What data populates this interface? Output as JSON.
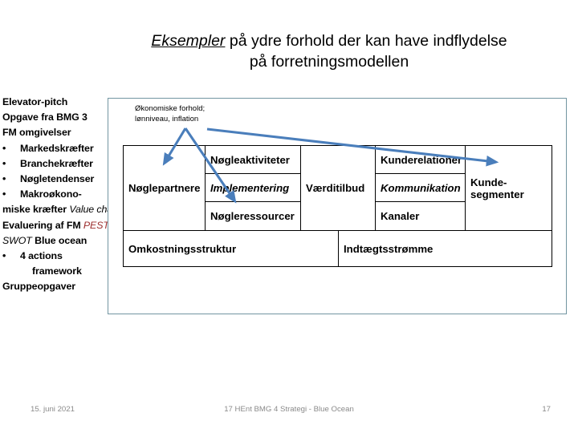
{
  "slide": {
    "title_emphasis": "Eksempler",
    "title_rest": " på ydre forhold der kan have indflydelse",
    "title_line2": "på forretningsmodellen"
  },
  "agenda": {
    "items": [
      {
        "text": "Elevator-pitch",
        "style": "bold"
      },
      {
        "text": "Opgave fra BMG 3",
        "style": "bold"
      },
      {
        "text": "FM omgivelser",
        "style": "bold"
      },
      {
        "text": "Markedskræfter",
        "style": "bullet"
      },
      {
        "text": "Branchekræfter",
        "style": "bullet"
      },
      {
        "text": "Nøgletendenser",
        "style": "bullet"
      },
      {
        "text": "Makroøkono-",
        "style": "bullet"
      },
      {
        "text": "miske kræfter",
        "style": "bold"
      },
      {
        "text": "Value chain",
        "style": "italic"
      },
      {
        "text": "Evaluering af FM",
        "style": "bold"
      },
      {
        "text": "PEST",
        "style": "pest"
      },
      {
        "text": "SWOT",
        "style": "swot"
      },
      {
        "text": "Blue ocean",
        "style": "bold"
      },
      {
        "text": "4 actions",
        "style": "bullet"
      },
      {
        "text": "framework",
        "style": "indent"
      },
      {
        "text": "Gruppeopgaver",
        "style": "bold"
      }
    ]
  },
  "annotation": {
    "econ_line1": "Økonomiske forhold;",
    "econ_line2": "lønniveau, inflation"
  },
  "canvas": {
    "cells": [
      {
        "name": "key-partners",
        "label": "Nøglepartnere",
        "italic": false
      },
      {
        "name": "key-activities",
        "label": "Nøgleaktiviteter",
        "italic": false
      },
      {
        "name": "implementation",
        "label": "Implementering",
        "italic": true
      },
      {
        "name": "key-resources",
        "label": "Nøgleressourcer",
        "italic": false
      },
      {
        "name": "value-proposition",
        "label": "Værditilbud",
        "italic": false
      },
      {
        "name": "customer-relationships",
        "label": "Kunderelationer",
        "italic": false
      },
      {
        "name": "communication",
        "label": "Kommunikation",
        "italic": true
      },
      {
        "name": "channels",
        "label": "Kanaler",
        "italic": false
      },
      {
        "name": "customer-segments",
        "label": "Kunde-\nsegmenter",
        "italic": false
      },
      {
        "name": "cost-structure",
        "label": "Omkostningsstruktur",
        "italic": false
      },
      {
        "name": "revenue-streams",
        "label": "Indtægtsstrømme",
        "italic": false
      }
    ]
  },
  "colors": {
    "arrow": "#4A7EBB",
    "panel_border": "#7295a1",
    "pest_red": "#9B2D2D",
    "footer_gray": "#8a8a8a"
  },
  "footer": {
    "date": "15. juni 2021",
    "center": "17 HEnt  BMG 4 Strategi - Blue Ocean",
    "page": "17"
  }
}
